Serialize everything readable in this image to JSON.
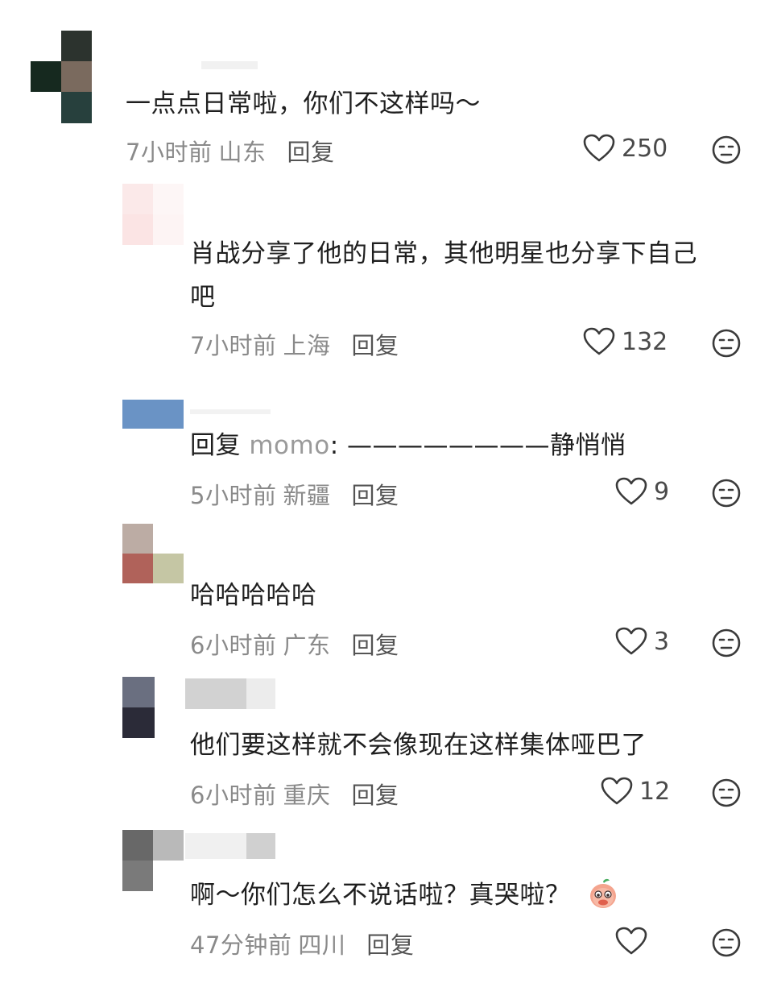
{
  "comments": [
    {
      "text": "一点点日常啦，你们不这样吗～",
      "time": "7小时前",
      "location": "山东",
      "reply_label": "回复",
      "likes": "250"
    },
    {
      "text_line1": "肖战分享了他的日常，其他明星也分享下自己",
      "text_line2": "吧",
      "time": "7小时前",
      "location": "上海",
      "reply_label": "回复",
      "likes": "132"
    },
    {
      "reply_prefix": "回复",
      "mention": "momo",
      "colon": ": ",
      "text": "————————静悄悄",
      "time": "5小时前",
      "location": "新疆",
      "reply_label": "回复",
      "likes": "9"
    },
    {
      "text": "哈哈哈哈哈",
      "time": "6小时前",
      "location": "广东",
      "reply_label": "回复",
      "likes": "3"
    },
    {
      "text": "他们要这样就不会像现在这样集体哑巴了",
      "time": "6小时前",
      "location": "重庆",
      "reply_label": "回复",
      "likes": "12"
    },
    {
      "text": "啊～你们怎么不说话啦？真哭啦？",
      "emoji": "peach-crying-emoji",
      "time": "47分钟前",
      "location": "四川",
      "reply_label": "回复",
      "likes": ""
    }
  ],
  "icons": {
    "like": "heart-outline-icon",
    "react": "neutral-face-icon"
  },
  "colors": {
    "text": "#1f1f1f",
    "meta": "#8a8a8a",
    "reply": "#545454",
    "mention": "#9a9a9a",
    "icon": "#3a3a3a"
  }
}
